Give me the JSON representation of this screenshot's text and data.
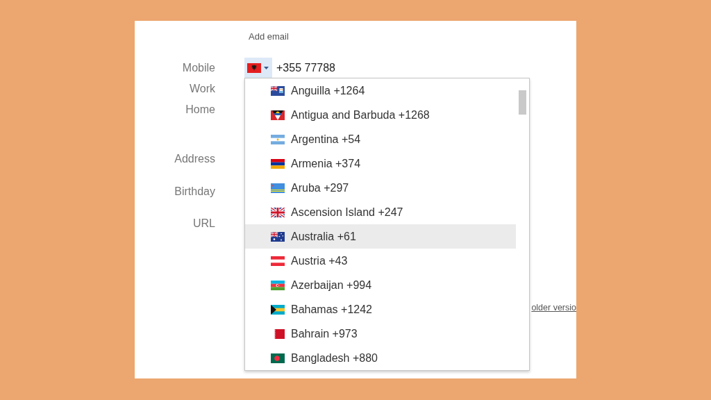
{
  "contact_form": {
    "add_email_link": "Add email",
    "fields": [
      {
        "label": "Mobile",
        "value": "+355 77788"
      },
      {
        "label": "Work"
      },
      {
        "label": "Home"
      },
      {
        "label": "Address"
      },
      {
        "label": "Birthday"
      },
      {
        "label": "URL"
      }
    ]
  },
  "country_dropdown": {
    "expanded": true,
    "items": [
      {
        "label": "Anguilla +1264",
        "selected": false
      },
      {
        "label": "Antigua and Barbuda +1268",
        "selected": false
      },
      {
        "label": "Argentina +54",
        "selected": false
      },
      {
        "label": "Armenia +374",
        "selected": false
      },
      {
        "label": "Aruba +297",
        "selected": false
      },
      {
        "label": "Ascension Island +247",
        "selected": false
      },
      {
        "label": "Australia +61",
        "selected": true
      },
      {
        "label": "Austria +43",
        "selected": false
      },
      {
        "label": "Azerbaijan +994",
        "selected": false
      },
      {
        "label": "Bahamas +1242",
        "selected": false
      },
      {
        "label": "Bahrain +973",
        "selected": false
      },
      {
        "label": "Bangladesh +880",
        "selected": false
      }
    ]
  },
  "footer": {
    "link": "older versio"
  }
}
